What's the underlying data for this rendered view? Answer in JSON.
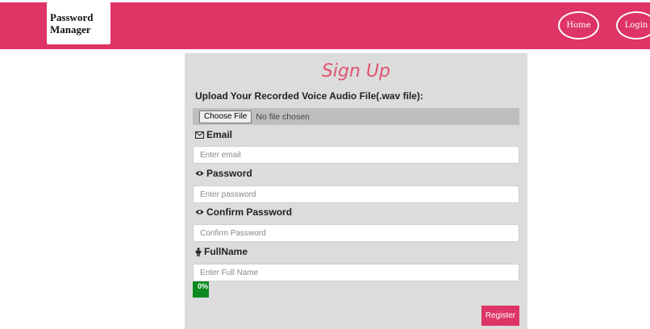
{
  "navbar": {
    "logo_line1": "Password",
    "logo_line2": "Manager",
    "home_label": "Home",
    "login_label": "Login",
    "color": "#de3466"
  },
  "form": {
    "title": "Sign Up",
    "upload_label": "Upload Your Recorded Voice Audio File(.wav file):",
    "file_button": "Choose File",
    "file_status": "No file chosen",
    "email_label": "Email",
    "email_icon": "envelope-icon",
    "email_placeholder": "Enter email",
    "password_label": "Password",
    "password_icon": "eye-icon",
    "password_placeholder": "Enter password",
    "confirm_label": "Confirm Password",
    "confirm_icon": "eye-icon",
    "confirm_placeholder": "Confirm Password",
    "fullname_label": "FullName",
    "fullname_icon": "person-icon",
    "fullname_placeholder": "Enter Full Name",
    "progress_text": "0%",
    "progress_value": 0,
    "register_label": "Register"
  }
}
